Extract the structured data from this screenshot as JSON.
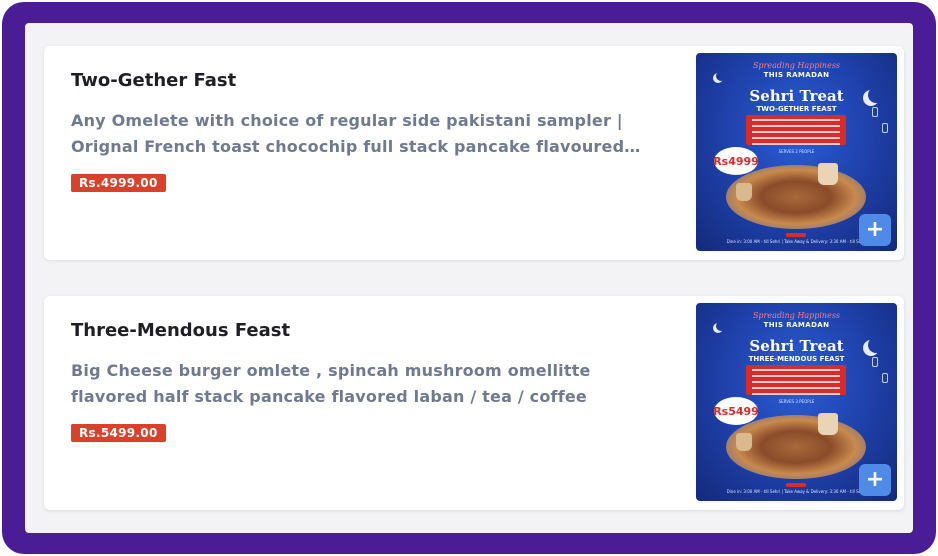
{
  "items": [
    {
      "title": "Two-Gether Fast",
      "description": "Any Omelete with choice of regular side pakistani sampler | Orignal French toast chocochip full stack pancake flavoured labaan / tea / coffee",
      "price": "Rs.4999.00",
      "promo": {
        "tagline": "Spreading Happiness",
        "subheading": "THIS RAMADAN",
        "headline": "Sehri Treat",
        "feast_name": "TWO-GETHER FEAST",
        "price_badge": "Rs4999",
        "serves": "SERVES 2 PEOPLE",
        "footer": "Dine in: 3:00 AM - till Sehri | Take Away & Delivery: 3:30 AM - till Sehri"
      },
      "add_label": "+"
    },
    {
      "title": "Three-Mendous Feast",
      "description": "Big Cheese burger omlete , spincah mushroom omellitte flavored half stack pancake flavored laban / tea / coffee",
      "price": "Rs.5499.00",
      "promo": {
        "tagline": "Spreading Happiness",
        "subheading": "THIS RAMADAN",
        "headline": "Sehri Treat",
        "feast_name": "THREE-MENDOUS FEAST",
        "price_badge": "Rs5499",
        "serves": "SERVES 3 PEOPLE",
        "footer": "Dine in: 3:00 AM - till Sehri | Take Away & Delivery: 3:30 AM - till Sehri"
      },
      "add_label": "+"
    }
  ],
  "colors": {
    "frame": "#4a1d96",
    "price_badge": "#d9412b",
    "add_button": "#4f8ae6"
  }
}
